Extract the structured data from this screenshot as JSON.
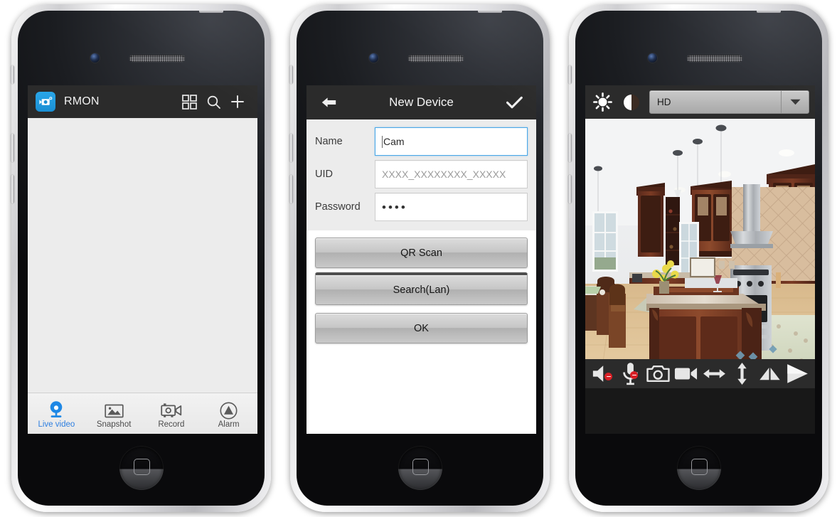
{
  "phone1": {
    "header": {
      "app_icon": "camcorder-app-icon",
      "title": "RMON",
      "grid_icon": "grid-view-icon",
      "search_icon": "search-icon",
      "add_icon": "plus-icon"
    },
    "content": {
      "empty": ""
    },
    "tabs": [
      {
        "label": "Live video",
        "icon": "webcam-icon",
        "active": true
      },
      {
        "label": "Snapshot",
        "icon": "photo-icon",
        "active": false
      },
      {
        "label": "Record",
        "icon": "camcorder-icon",
        "active": false
      },
      {
        "label": "Alarm",
        "icon": "warning-icon",
        "active": false
      }
    ],
    "accent_color": "#2e7fe0"
  },
  "phone2": {
    "header": {
      "back_icon": "back-arrow-icon",
      "title": "New Device",
      "confirm_icon": "checkmark-icon"
    },
    "fields": [
      {
        "label": "Name",
        "value": "Cam",
        "placeholder": "",
        "focused": true,
        "type": "text"
      },
      {
        "label": "UID",
        "value": "",
        "placeholder": "XXXX_XXXXXXXX_XXXXX",
        "focused": false,
        "type": "text"
      },
      {
        "label": "Password",
        "value": "••••",
        "placeholder": "",
        "focused": false,
        "type": "password"
      }
    ],
    "buttons": [
      {
        "label": "QR Scan"
      },
      {
        "label": "Search(Lan)"
      },
      {
        "label": "OK"
      }
    ]
  },
  "phone3": {
    "toolbar": {
      "brightness_icon": "brightness-sun-icon",
      "contrast_icon": "contrast-icon",
      "quality_value": "HD",
      "quality_arrow": "chevron-down-icon"
    },
    "video": {
      "scene": "kitchen-live-view"
    },
    "controls": [
      {
        "name": "speaker-mute-icon",
        "label": "Speaker"
      },
      {
        "name": "microphone-mute-icon",
        "label": "Microphone"
      },
      {
        "name": "snapshot-camera-icon",
        "label": "Snapshot"
      },
      {
        "name": "record-camcorder-icon",
        "label": "Record"
      },
      {
        "name": "pan-horizontal-icon",
        "label": "Pan"
      },
      {
        "name": "tilt-vertical-icon",
        "label": "Tilt"
      },
      {
        "name": "mirror-flip-icon",
        "label": "Mirror"
      },
      {
        "name": "flip-play-icon",
        "label": "Flip"
      }
    ]
  }
}
